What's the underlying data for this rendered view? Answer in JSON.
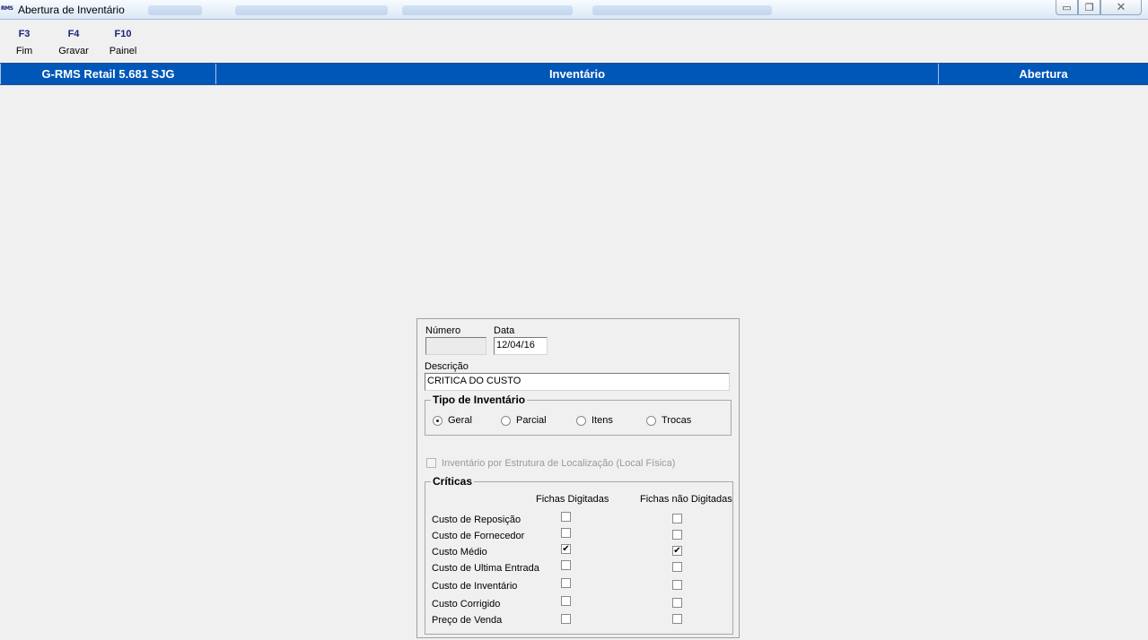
{
  "window": {
    "logo_text": "RMS",
    "title": "Abertura de Inventário",
    "minimize_glyph": "▭",
    "restore_glyph": "❐",
    "close_glyph": "✕"
  },
  "toolbar": {
    "keys": [
      {
        "key": "F3",
        "label": "Fim"
      },
      {
        "key": "F4",
        "label": "Gravar"
      },
      {
        "key": "F10",
        "label": "Painel"
      }
    ]
  },
  "header": {
    "system": "G-RMS Retail 5.681 SJG",
    "module": "Inventário",
    "screen": "Abertura"
  },
  "form": {
    "numero": {
      "label": "Número",
      "value": ""
    },
    "data": {
      "label": "Data",
      "value": "12/04/16"
    },
    "descricao": {
      "label": "Descrição",
      "value": "CRITICA DO CUSTO"
    },
    "tipo": {
      "title": "Tipo de Inventário",
      "options": [
        {
          "label": "Geral",
          "checked": true
        },
        {
          "label": "Parcial",
          "checked": false
        },
        {
          "label": "Itens",
          "checked": false
        },
        {
          "label": "Trocas",
          "checked": false
        }
      ]
    },
    "estrutura": {
      "label": "Inventário por Estrutura de Localização (Local Física)",
      "checked": false,
      "enabled": false
    },
    "criticas": {
      "title": "Críticas",
      "col_digitadas": "Fichas Digitadas",
      "col_nao_digitadas": "Fichas não Digitadas",
      "rows": [
        {
          "label": "Custo de Reposição",
          "digitadas": false,
          "nao_digitadas": false
        },
        {
          "label": "Custo de Fornecedor",
          "digitadas": false,
          "nao_digitadas": false
        },
        {
          "label": "Custo Médio",
          "digitadas": true,
          "nao_digitadas": true
        },
        {
          "label": "Custo de Ultima Entrada",
          "digitadas": false,
          "nao_digitadas": false
        },
        {
          "label": "Custo de Inventário",
          "digitadas": false,
          "nao_digitadas": false
        },
        {
          "label": "Custo Corrigido",
          "digitadas": false,
          "nao_digitadas": false
        },
        {
          "label": "Preço de Venda",
          "digitadas": false,
          "nao_digitadas": false
        }
      ]
    }
  },
  "colors": {
    "header_band": "#0057b8",
    "fkey_text": "#1a237e",
    "window_bg": "#f0f0f0"
  }
}
